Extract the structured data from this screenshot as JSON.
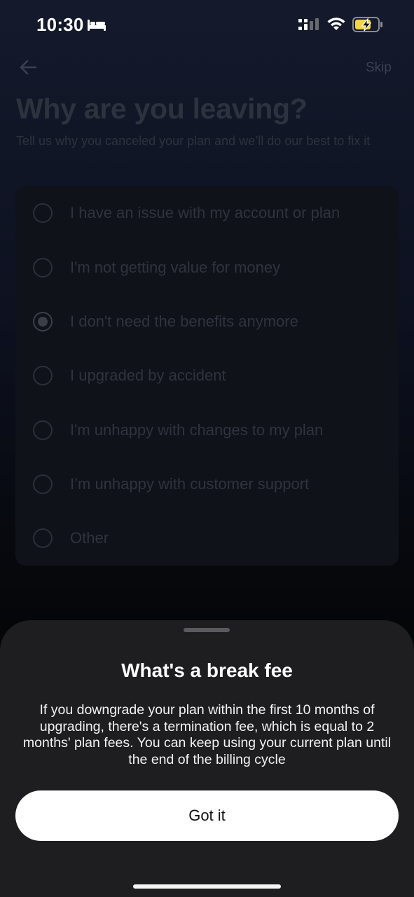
{
  "status_bar": {
    "time": "10:30",
    "icons": [
      "bed-icon",
      "signal-icon",
      "wifi-icon",
      "battery-charging-icon"
    ]
  },
  "header": {
    "back_icon": "arrow-left-icon",
    "skip_label": "Skip"
  },
  "survey": {
    "title": "Why are you leaving?",
    "subtitle": "Tell us why you canceled your plan and we’ll do our best to fix it",
    "options": [
      {
        "label": "I have an issue with my account or plan",
        "selected": false
      },
      {
        "label": "I'm not getting value for money",
        "selected": false
      },
      {
        "label": "I don't need the benefits anymore",
        "selected": true
      },
      {
        "label": "I upgraded by accident",
        "selected": false
      },
      {
        "label": "I'm unhappy with changes to my plan",
        "selected": false
      },
      {
        "label": "I’m unhappy with customer support",
        "selected": false
      },
      {
        "label": "Other",
        "selected": false
      }
    ]
  },
  "sheet": {
    "title": "What's a break fee",
    "body": "If you downgrade your plan within the first 10 months of upgrading, there's a termination fee, which is equal to 2 months' plan fees. You can keep using your current plan until the end of the billing cycle",
    "button_label": "Got it"
  },
  "colors": {
    "sheet_background": "#1e1e20",
    "button_background": "#ffffff",
    "battery_accent": "#f5d547"
  }
}
